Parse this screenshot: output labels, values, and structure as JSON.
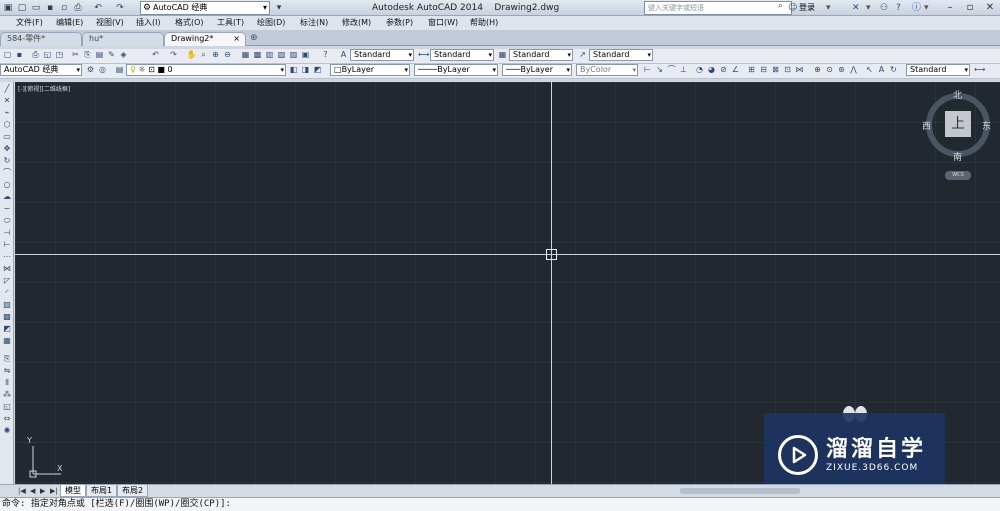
{
  "titlebar": {
    "workspace": "AutoCAD 经典",
    "title": "Autodesk AutoCAD 2014    Drawing2.dwg",
    "search_placeholder": "键入关键字或短语",
    "login": "登录"
  },
  "menu": [
    "文件(F)",
    "编辑(E)",
    "视图(V)",
    "插入(I)",
    "格式(O)",
    "工具(T)",
    "绘图(D)",
    "标注(N)",
    "修改(M)",
    "参数(P)",
    "窗口(W)",
    "帮助(H)"
  ],
  "tabs": [
    {
      "label": "584-零件*",
      "active": false
    },
    {
      "label": "hu*",
      "active": false
    },
    {
      "label": "Drawing2*",
      "active": true
    }
  ],
  "toolbar1": {
    "text_style": "Standard",
    "dim_style": "Standard",
    "table_style": "Standard",
    "mleader_style": "Standard"
  },
  "toolbar2": {
    "workspace": "AutoCAD 经典",
    "layer": "0",
    "color": "ByLayer",
    "linetype": "ByLayer",
    "lineweight": "ByLayer",
    "plotstyle": "ByColor",
    "dim_style": "Standard"
  },
  "canvas": {
    "viewport_label": "[-][俯视][二维线框]",
    "viewcube": {
      "north": "北",
      "south": "南",
      "east": "东",
      "west": "西",
      "top": "上",
      "wcs": "WCS"
    },
    "ucs": {
      "x": "X",
      "y": "Y"
    }
  },
  "watermark": {
    "title": "溜溜自学",
    "url": "ZIXUE.3D66.COM"
  },
  "layout_tabs": [
    {
      "label": "模型",
      "active": true
    },
    {
      "label": "布局1",
      "active": false
    },
    {
      "label": "布局2",
      "active": false
    }
  ],
  "command_line": "命令: 指定对角点或 [栏选(F)/圈围(WP)/圈交(CP)]:",
  "colors": {
    "canvas_bg": "#212830",
    "grid": "#2a323c",
    "crosshair": "#cfd4da",
    "watermark_bg": "#1d3463"
  }
}
